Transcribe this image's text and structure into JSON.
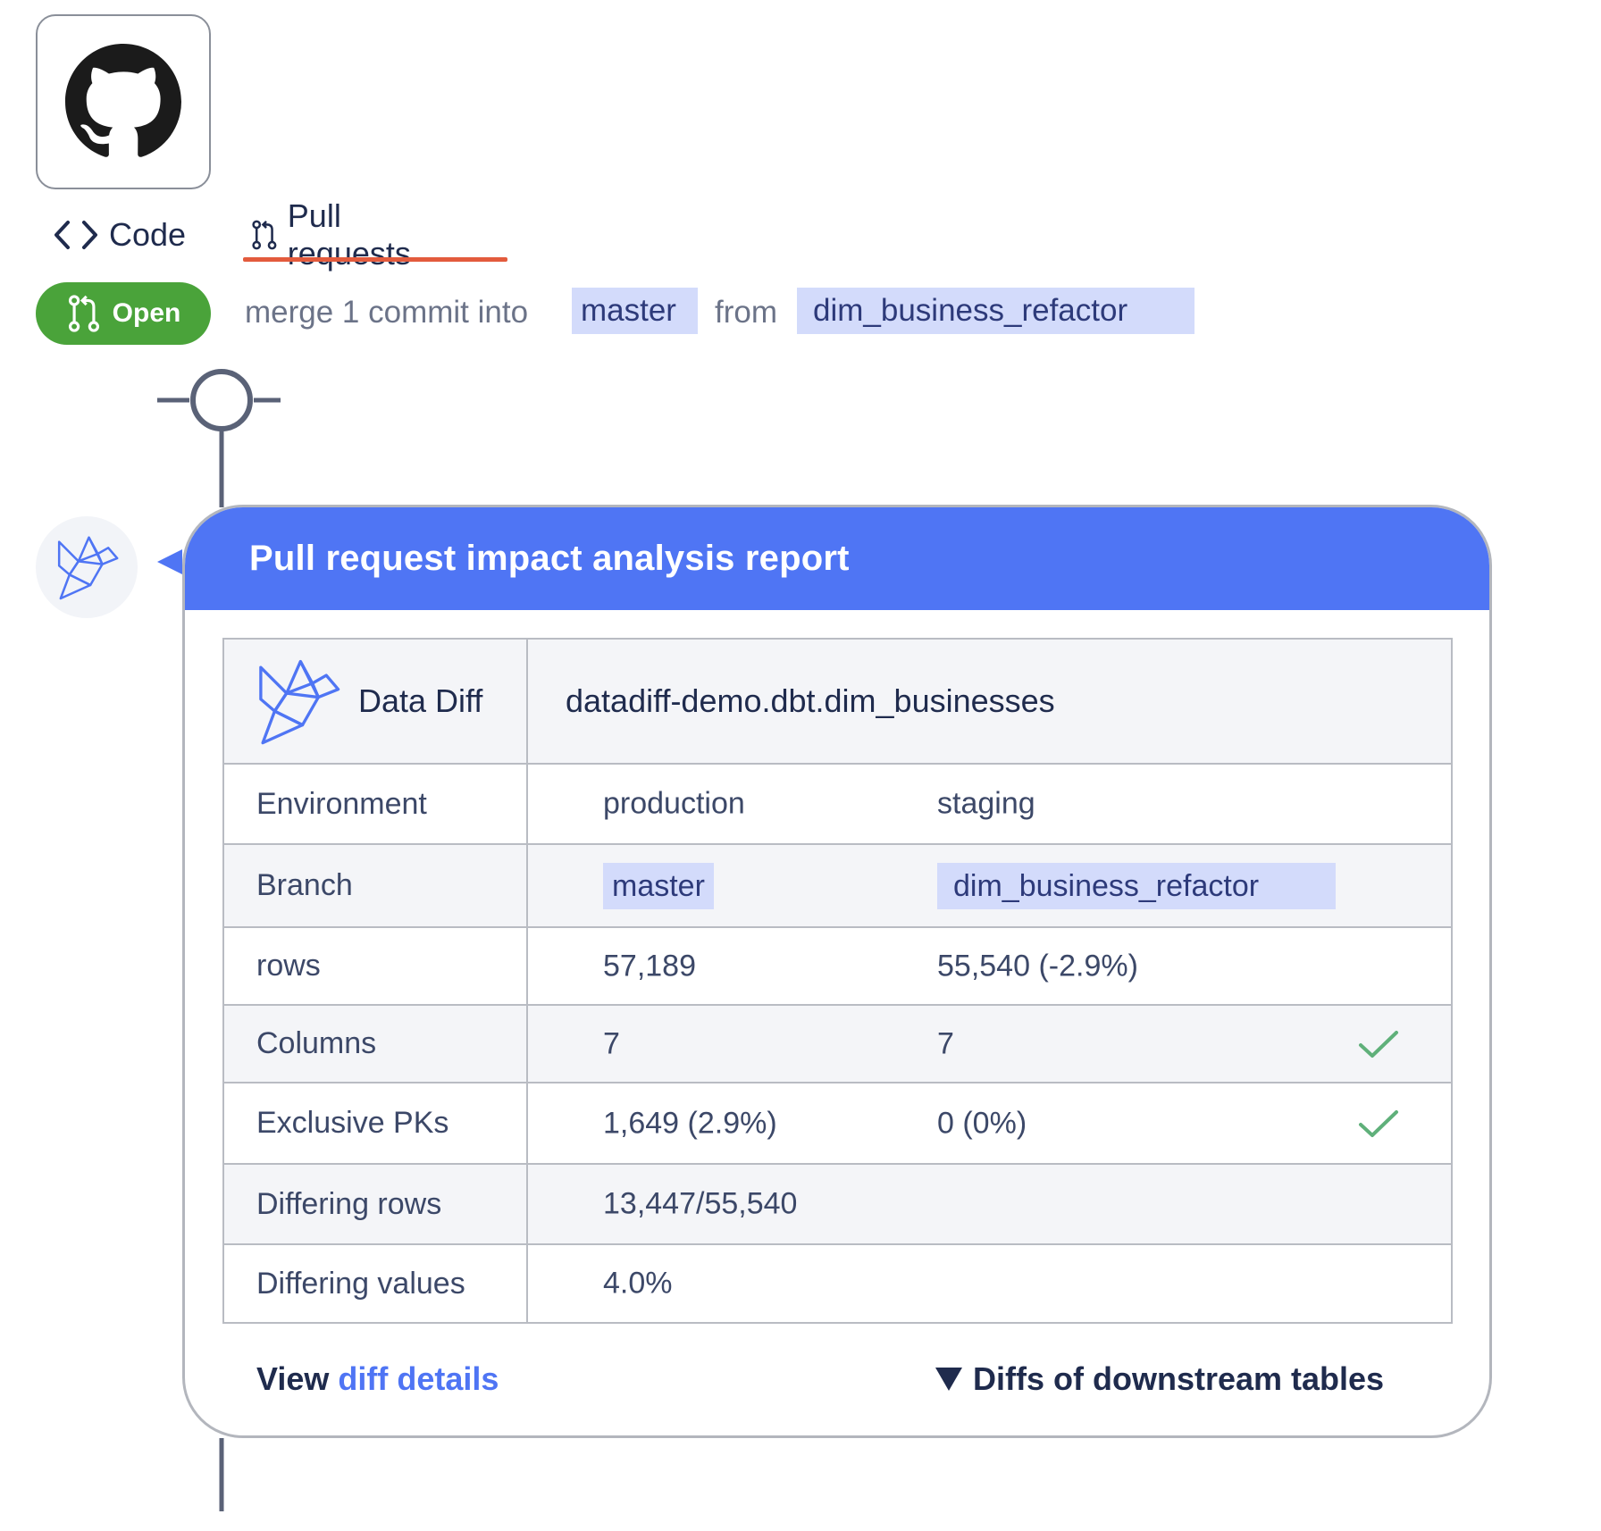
{
  "tabs": {
    "code": "Code",
    "pull_requests": "Pull requests"
  },
  "pr": {
    "status": "Open",
    "merge_text": "merge 1 commit into",
    "base_branch": "master",
    "from_text": "from",
    "head_branch": "dim_business_refactor"
  },
  "report": {
    "title": "Pull request impact analysis report",
    "tool_name": "Data Diff",
    "table_name": "datadiff-demo.dbt.dim_businesses",
    "rows": {
      "environment": {
        "label": "Environment",
        "a": "production",
        "b": "staging"
      },
      "branch": {
        "label": "Branch",
        "a": "master",
        "b": "dim_business_refactor"
      },
      "row_count": {
        "label": "rows",
        "a": "57,189",
        "b": "55,540 (-2.9%)"
      },
      "columns": {
        "label": "Columns",
        "a": "7",
        "b": "7"
      },
      "exclusive_pks": {
        "label": "Exclusive PKs",
        "a": "1,649 (2.9%)",
        "b": "0 (0%)"
      },
      "differing_rows": {
        "label": "Differing rows",
        "a": "13,447/55,540"
      },
      "differing_values": {
        "label": "Differing values",
        "a": "4.0%"
      }
    },
    "footer": {
      "view_prefix": "View",
      "view_link": "diff details",
      "downstream": "Diffs of downstream tables"
    }
  },
  "colors": {
    "accent": "#4f75f4",
    "open_green": "#4aa33a",
    "tab_underline": "#e35b3d",
    "chip_bg": "#d3dbfb",
    "check": "#5fb07a"
  }
}
